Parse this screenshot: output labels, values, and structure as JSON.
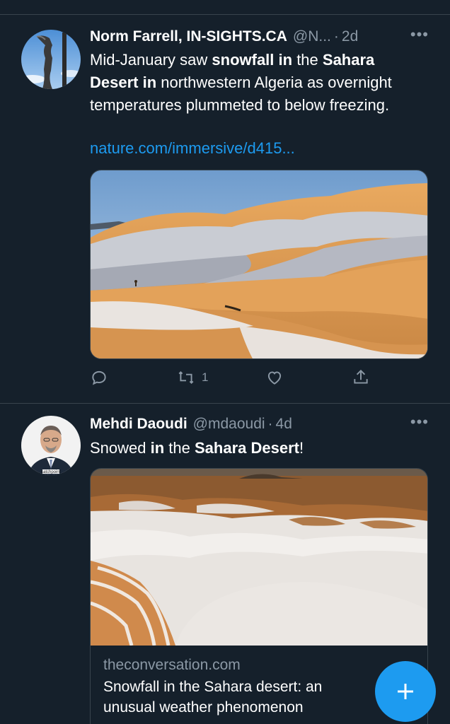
{
  "tweets": [
    {
      "author": "Norm Farrell, IN-SIGHTS.CA",
      "handle": "@N...",
      "time": "2d",
      "text": [
        {
          "t": "Mid-January saw ",
          "b": false
        },
        {
          "t": "snowfall in",
          "b": true
        },
        {
          "t": " the ",
          "b": false
        },
        {
          "t": "Sahara Desert in",
          "b": true
        },
        {
          "t": " northwestern Algeria as overnight temperatures plummeted to below freezing.",
          "b": false
        }
      ],
      "link": "nature.com/immersive/d415...",
      "actions": {
        "reply": "",
        "retweet": "1",
        "like": "",
        "share": ""
      }
    },
    {
      "author": "Mehdi Daoudi",
      "handle": "@mdaoudi",
      "time": "4d",
      "text": [
        {
          "t": "Snowed ",
          "b": false
        },
        {
          "t": "in",
          "b": true
        },
        {
          "t": " the ",
          "b": false
        },
        {
          "t": "Sahara Desert",
          "b": true
        },
        {
          "t": "!",
          "b": false
        }
      ],
      "card": {
        "domain": "theconversation.com",
        "title": "Snowfall in the Sahara desert: an unusual weather phenomenon"
      },
      "avatar_caption": "catchpoint"
    }
  ],
  "more_label": "•••",
  "dot": "·",
  "fab_label": "+",
  "colors": {
    "background": "#15202b",
    "accent": "#1d9bf0",
    "secondary_text": "#8b98a5",
    "divider": "#38444d"
  },
  "icons": [
    "reply-icon",
    "retweet-icon",
    "like-icon",
    "share-icon",
    "compose-icon"
  ]
}
